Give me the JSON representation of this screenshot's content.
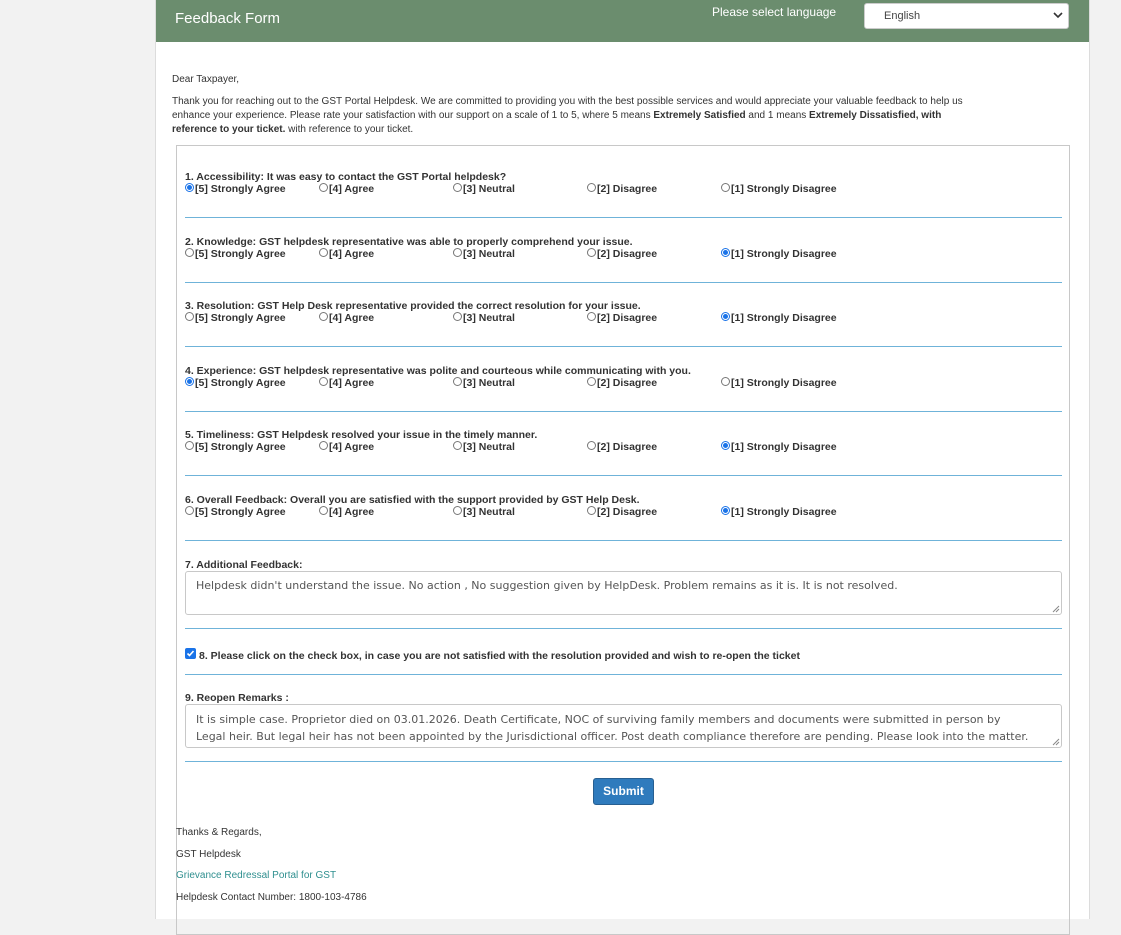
{
  "header": {
    "title": "Feedback Form",
    "language_label": "Please select language",
    "language_selected": "English"
  },
  "intro": {
    "greeting": "Dear Taxpayer,",
    "line1": "Thank you for reaching out to the GST Portal Helpdesk. We are committed to providing you with the best possible services and would appreciate your valuable feedback to help us",
    "line2_a": "enhance your experience. Please rate your satisfaction with our support on a scale of 1 to 5, where 5 means ",
    "line2_b": "Extremely Satisfied",
    "line2_c": " and 1 means ",
    "line2_d": "Extremely Dissatisfied, with",
    "line3_a": "reference to your ticket.",
    "line3_b": " with reference to your ticket."
  },
  "options": [
    "[5] Strongly Agree",
    "[4] Agree",
    "[3] Neutral",
    "[2] Disagree",
    "[1] Strongly Disagree"
  ],
  "questions": [
    {
      "title": "1. Accessibility: It was easy to contact the GST Portal helpdesk?",
      "selected": "[5] Strongly Agree"
    },
    {
      "title": "2. Knowledge: GST helpdesk representative was able to properly comprehend your issue.",
      "selected": "[1] Strongly Disagree"
    },
    {
      "title": "3. Resolution: GST Help Desk representative provided the correct resolution for your issue.",
      "selected": "[1] Strongly Disagree"
    },
    {
      "title": "4. Experience: GST helpdesk representative was polite and courteous while communicating with you.",
      "selected": "[5] Strongly Agree"
    },
    {
      "title": "5. Timeliness: GST Helpdesk resolved your issue in the timely manner.",
      "selected": "[1] Strongly Disagree"
    },
    {
      "title": "6. Overall Feedback: Overall you are satisfied with the support provided by GST Help Desk.",
      "selected": "[1] Strongly Disagree"
    }
  ],
  "additional_feedback": {
    "label": "7. Additional Feedback:",
    "value": "Helpdesk didn't understand the issue.   No action , No suggestion given by HelpDesk.  Problem remains as it is. It is not resolved."
  },
  "reopen_check": {
    "label": "8. Please click on the check box, in case you are not satisfied with the resolution provided and wish to re-open the ticket",
    "checked": true
  },
  "reopen_remarks": {
    "label": "9. Reopen Remarks :",
    "line1": "It is simple case. Proprietor died on 03.01.2026. Death Certificate, NOC of surviving family members and documents were submitted in person by",
    "line2": "Legal heir. But legal heir has not been appointed by the Jurisdictional officer. Post death compliance therefore are pending. Please look into the matter."
  },
  "submit_label": "Submit",
  "footer": {
    "regards": "Thanks & Regards,",
    "team": "GST Helpdesk",
    "link": "Grievance Redressal Portal for GST",
    "contact": "Helpdesk Contact Number: 1800-103-4786"
  },
  "colors": {
    "header_bg": "#6b8d6e",
    "separator": "#6fb3d9",
    "submit_bg": "#2f7bbd",
    "radio_selected": "#1a73e8",
    "link": "#2f8f8f"
  }
}
